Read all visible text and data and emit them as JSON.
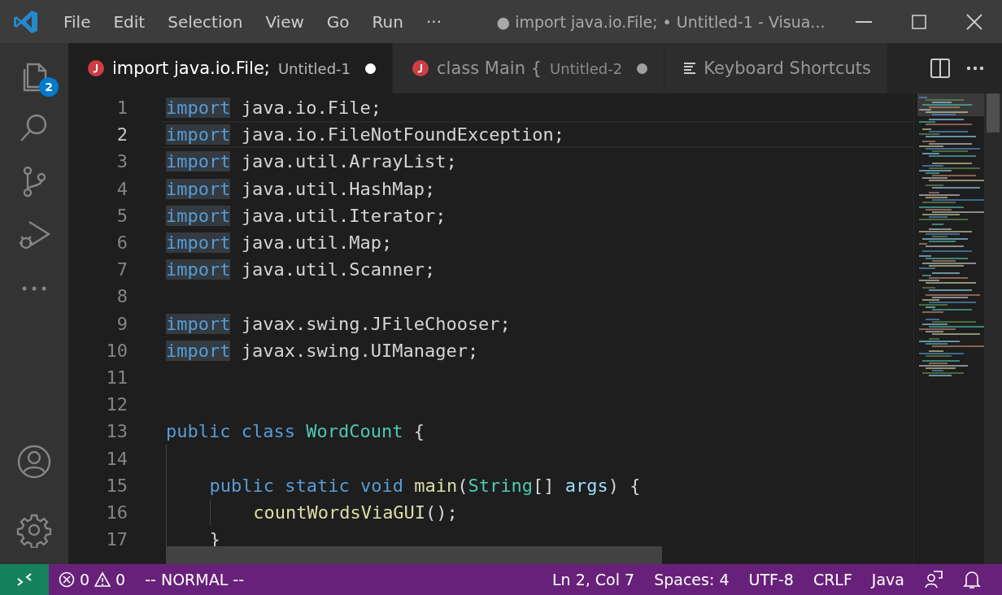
{
  "title_bar": {
    "menus": [
      "File",
      "Edit",
      "Selection",
      "View",
      "Go",
      "Run"
    ],
    "more": "···",
    "title": "● import java.io.File; • Untitled-1 - Visua..."
  },
  "activity_bar": {
    "items": [
      {
        "kind": "files",
        "badge": "2"
      },
      {
        "kind": "search"
      },
      {
        "kind": "source-control"
      },
      {
        "kind": "run"
      },
      {
        "kind": "more"
      },
      {
        "kind": "account"
      },
      {
        "kind": "settings"
      }
    ]
  },
  "tabs": [
    {
      "kind": "java",
      "label": "import java.io.File;",
      "description": "Untitled-1",
      "dirty": true,
      "selected": true
    },
    {
      "kind": "java",
      "label": "class Main {",
      "description": "Untitled-2",
      "dirty": true,
      "selected": false
    },
    {
      "kind": "shortcuts",
      "label": "Keyboard Shortcuts",
      "dirty": false,
      "selected": false
    }
  ],
  "editor": {
    "lines": [
      {
        "number": "1",
        "current": false,
        "tokens": [
          {
            "kind": "keyword",
            "text": "import",
            "highlighted": true
          },
          {
            "kind": "plain",
            "text": " java.io.File;"
          }
        ]
      },
      {
        "number": "2",
        "current": true,
        "tokens": [
          {
            "kind": "keyword",
            "text": "import",
            "highlighted": true
          },
          {
            "kind": "plain",
            "text": " java.io.FileNotFoundException;"
          }
        ]
      },
      {
        "number": "3",
        "current": false,
        "tokens": [
          {
            "kind": "keyword",
            "text": "import",
            "highlighted": true
          },
          {
            "kind": "plain",
            "text": " java.util.ArrayList;"
          }
        ]
      },
      {
        "number": "4",
        "current": false,
        "tokens": [
          {
            "kind": "keyword",
            "text": "import",
            "highlighted": true
          },
          {
            "kind": "plain",
            "text": " java.util.HashMap;"
          }
        ]
      },
      {
        "number": "5",
        "current": false,
        "tokens": [
          {
            "kind": "keyword",
            "text": "import",
            "highlighted": true
          },
          {
            "kind": "plain",
            "text": " java.util.Iterator;"
          }
        ]
      },
      {
        "number": "6",
        "current": false,
        "tokens": [
          {
            "kind": "keyword",
            "text": "import",
            "highlighted": true
          },
          {
            "kind": "plain",
            "text": " java.util.Map;"
          }
        ]
      },
      {
        "number": "7",
        "current": false,
        "tokens": [
          {
            "kind": "keyword",
            "text": "import",
            "highlighted": true
          },
          {
            "kind": "plain",
            "text": " java.util.Scanner;"
          }
        ]
      },
      {
        "number": "8",
        "current": false
      },
      {
        "number": "9",
        "current": false,
        "tokens": [
          {
            "kind": "keyword",
            "text": "import",
            "highlighted": true
          },
          {
            "kind": "plain",
            "text": " javax.swing.JFileChooser;"
          }
        ]
      },
      {
        "number": "10",
        "current": false,
        "tokens": [
          {
            "kind": "keyword",
            "text": "import",
            "highlighted": true
          },
          {
            "kind": "plain",
            "text": " javax.swing.UIManager;"
          }
        ]
      },
      {
        "number": "11",
        "current": false
      },
      {
        "number": "12",
        "current": false
      },
      {
        "number": "13",
        "current": false,
        "tokens": [
          {
            "kind": "keyword",
            "text": "public class ",
            "highlighted": false
          },
          {
            "kind": "type",
            "text": "WordCount"
          },
          {
            "kind": "plain",
            "text": " {"
          }
        ],
        "children": [
          {
            "number": "14",
            "current": false
          },
          {
            "number": "15",
            "current": false,
            "tokens": [
              {
                "kind": "keyword",
                "text": "public static void ",
                "highlighted": false
              },
              {
                "kind": "function",
                "text": "main"
              },
              {
                "kind": "plain",
                "text": "("
              },
              {
                "kind": "type",
                "text": "String"
              },
              {
                "kind": "plain",
                "text": "[] "
              },
              {
                "kind": "variable",
                "text": "args"
              },
              {
                "kind": "plain",
                "text": ") {"
              }
            ],
            "children": [
              {
                "number": "16",
                "current": false,
                "tokens": [
                  {
                    "kind": "function",
                    "text": "countWordsViaGUI"
                  },
                  {
                    "kind": "plain",
                    "text": "();"
                  }
                ]
              }
            ]
          },
          {
            "number": "17",
            "current": false,
            "tokens": [
              {
                "kind": "plain",
                "text": "}"
              }
            ]
          }
        ]
      }
    ]
  },
  "status_bar": {
    "problems": {
      "errors": "0",
      "warnings": "0"
    },
    "mode": "-- NORMAL --",
    "items": [
      "Ln 2, Col 7",
      "Spaces: 4",
      "UTF-8",
      "CRLF",
      "Java"
    ]
  }
}
